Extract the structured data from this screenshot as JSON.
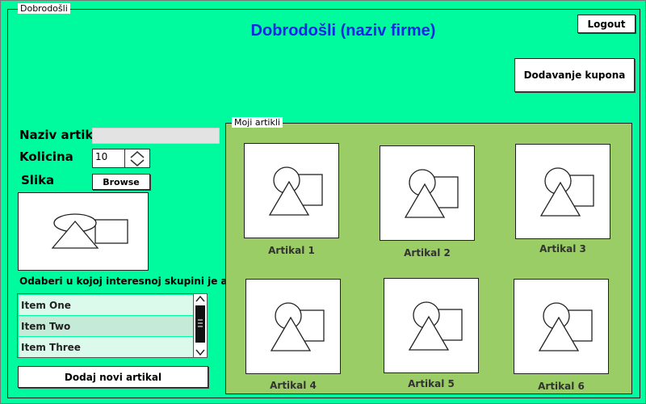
{
  "window": {
    "legend": "Dobrodošli"
  },
  "header": {
    "title": "Dobrodošli (naziv firme)",
    "logout_label": "Logout",
    "coupon_label": "Dodavanje kupona"
  },
  "form": {
    "name_label": "Naziv artikla",
    "name_value": "",
    "qty_label": "Kolicina",
    "qty_value": "10",
    "image_label": "Slika",
    "browse_label": "Browse",
    "group_label": "Odaberi u kojoj interesnoj skupini je artikal",
    "groups": [
      "Item One",
      "Item Two",
      "Item Three"
    ],
    "add_label": "Dodaj novi artikal"
  },
  "articles_panel": {
    "legend": "Moji artikli",
    "items": [
      {
        "label": "Artikal 1"
      },
      {
        "label": "Artikal 2"
      },
      {
        "label": "Artikal 3"
      },
      {
        "label": "Artikal 4"
      },
      {
        "label": "Artikal 5"
      },
      {
        "label": "Artikal 6"
      }
    ]
  },
  "colors": {
    "background": "#00fa9e",
    "panel": "#9acd65",
    "title": "#1526e6"
  }
}
